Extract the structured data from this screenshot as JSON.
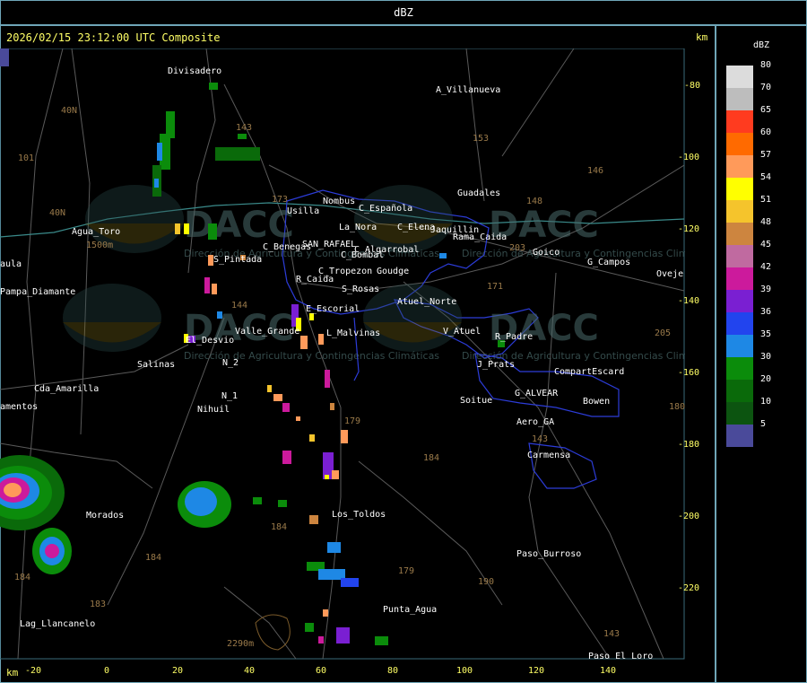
{
  "header": {
    "title": "dBZ"
  },
  "map": {
    "timestamp": "2026/02/15 23:12:00 UTC Composite",
    "km_label": "km",
    "watermark_text": "DACC",
    "watermark_subtitle": "Dirección de Agricultura y Contingencias Climáticas",
    "x_ticks": [
      "-20",
      "0",
      "20",
      "40",
      "60",
      "80",
      "100",
      "120",
      "140"
    ],
    "y_ticks": [
      "-80",
      "-100",
      "-120",
      "-140",
      "-160",
      "-180",
      "-200",
      "-220"
    ],
    "places": [
      {
        "name": "Divisadero"
      },
      {
        "name": "A_Villanueva"
      },
      {
        "name": "Guadales"
      },
      {
        "name": "Usilla"
      },
      {
        "name": "Nombus"
      },
      {
        "name": "C_Española"
      },
      {
        "name": "La_Nora"
      },
      {
        "name": "C_Elena"
      },
      {
        "name": "Jaquillin"
      },
      {
        "name": "Rama_Caida"
      },
      {
        "name": "Agua_Toro"
      },
      {
        "name": "Pampa_Diamante"
      },
      {
        "name": "C_Benegas"
      },
      {
        "name": "SAN_RAFAEL"
      },
      {
        "name": "C_Algarrobal"
      },
      {
        "name": "C_Bombal"
      },
      {
        "name": "S_Pintada"
      },
      {
        "name": "C_Tropezon"
      },
      {
        "name": "Goudge"
      },
      {
        "name": "R_Caida"
      },
      {
        "name": "S_Rosas"
      },
      {
        "name": "Goico"
      },
      {
        "name": "G_Campos"
      },
      {
        "name": "Atuel_Norte"
      },
      {
        "name": "E_Escorial"
      },
      {
        "name": "Valle_Grande"
      },
      {
        "name": "L_Malvinas"
      },
      {
        "name": "El_Desvio"
      },
      {
        "name": "V_Atuel"
      },
      {
        "name": "R_Padre"
      },
      {
        "name": "Salinas"
      },
      {
        "name": "N_2"
      },
      {
        "name": "J_Prats"
      },
      {
        "name": "CompartEscard"
      },
      {
        "name": "Cda_Amarilla"
      },
      {
        "name": "N_1"
      },
      {
        "name": "G_ALVEAR"
      },
      {
        "name": "Soitue"
      },
      {
        "name": "Bowen"
      },
      {
        "name": "Nihuil"
      },
      {
        "name": "Aero_GA"
      },
      {
        "name": "Carmensa"
      },
      {
        "name": "Morados"
      },
      {
        "name": "Los_Toldos"
      },
      {
        "name": "Paso_Burroso"
      },
      {
        "name": "Punta_Agua"
      },
      {
        "name": "Lag_Llancanelo"
      },
      {
        "name": "Paso_El_Loro"
      },
      {
        "name": "Oveje"
      },
      {
        "name": "amentos"
      },
      {
        "name": "aula"
      }
    ],
    "route_numbers": [
      "40N",
      "40N",
      "101",
      "143",
      "153",
      "146",
      "148",
      "203",
      "171",
      "144",
      "173",
      "184",
      "184",
      "179",
      "190",
      "143",
      "184",
      "183",
      "184",
      "205",
      "180",
      "143",
      "2290m",
      "1500m"
    ]
  },
  "legend": {
    "title": "dBZ",
    "colors": [
      "#dcdcdc",
      "#bdbdbd",
      "#ff3b1f",
      "#ff6a00",
      "#ff9a5a",
      "#ffff00",
      "#f5c42c",
      "#cd853f",
      "#c06aa0",
      "#cc1a9c",
      "#7a1fd2",
      "#2244ee",
      "#1e88e5",
      "#0b8c0b",
      "#0a6a0a",
      "#0c5410",
      "#4a4a9a"
    ],
    "values": [
      "80",
      "70",
      "65",
      "60",
      "57",
      "54",
      "51",
      "48",
      "45",
      "42",
      "39",
      "36",
      "35",
      "30",
      "20",
      "10",
      "5"
    ]
  }
}
